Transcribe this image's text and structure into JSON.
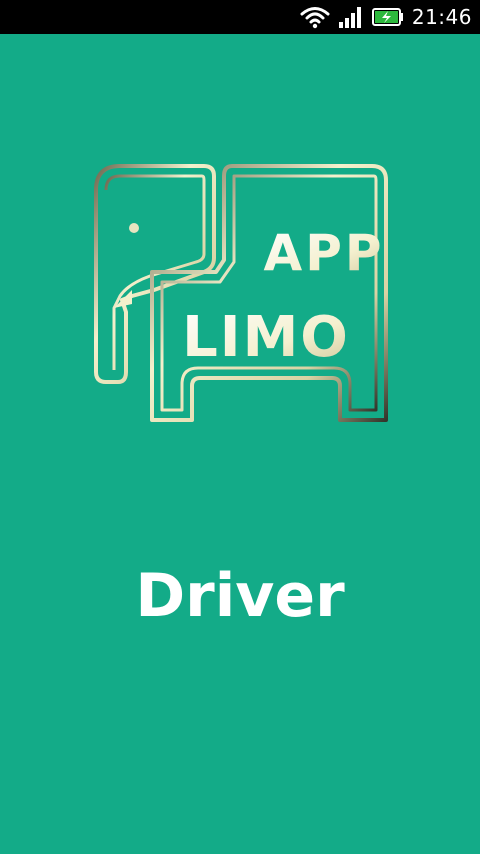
{
  "status_bar": {
    "time": "21:46",
    "icons": [
      "wifi-icon",
      "signal-icon",
      "battery-charging-icon"
    ]
  },
  "logo": {
    "line1": "APP",
    "line2": "LIMO",
    "icon": "elephant-icon"
  },
  "splash": {
    "role": "Driver"
  },
  "colors": {
    "background": "#13ab88",
    "status_bar": "#000000",
    "logo_gold": "#e9e4b8",
    "text": "#ffffff"
  }
}
